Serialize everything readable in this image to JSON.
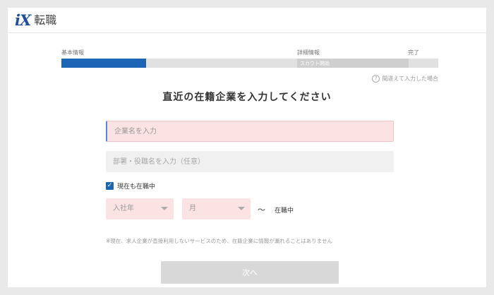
{
  "header": {
    "logo_mark": "iX",
    "logo_text": "転職"
  },
  "steps": {
    "labels": [
      "基本情報",
      "詳細情報",
      "完了"
    ],
    "current_sublabel": "スカウト開始",
    "progress_fraction": 0.225
  },
  "help": {
    "icon": "question-circle-icon",
    "text": "間違えて入力した場合"
  },
  "title": "直近の在籍企業を入力してください",
  "form": {
    "company_placeholder": "企業名を入力",
    "dept_placeholder": "部署・役職名を入力（任意）",
    "currently_employed_label": "現在も在職中",
    "currently_employed_checked": true,
    "join_year_placeholder": "入社年",
    "join_month_placeholder": "月",
    "range_separator": "～",
    "current_text": "在職中",
    "note": "※現在、求人企業が直接利用しないサービスのため、在籍企業に情報が漏れることはありません",
    "next_label": "次へ"
  },
  "colors": {
    "accent": "#1c64b4",
    "field_error_bg": "#fce3e3",
    "button_disabled": "#d8d8d8"
  }
}
